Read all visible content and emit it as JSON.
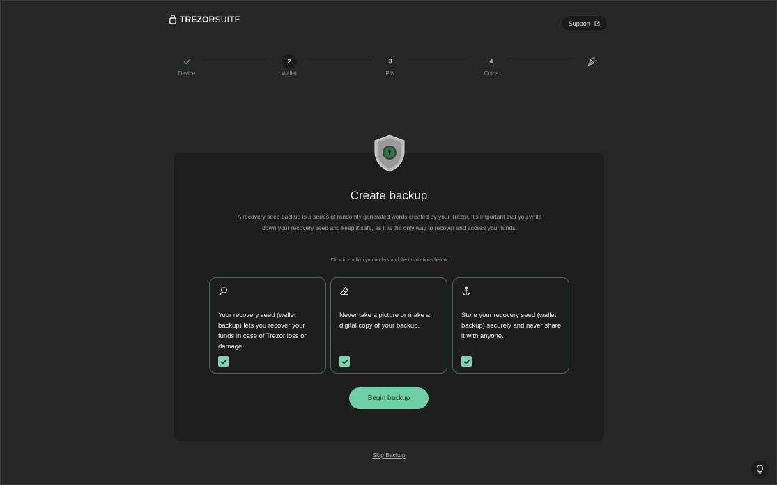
{
  "header": {
    "logo_bold": "TREZOR",
    "logo_light": "SUITE",
    "support_label": "Support"
  },
  "stepper": {
    "steps": [
      {
        "number": "✓",
        "label": "Device",
        "state": "done"
      },
      {
        "number": "2",
        "label": "Wallet",
        "state": "active"
      },
      {
        "number": "3",
        "label": "PIN",
        "state": "pending"
      },
      {
        "number": "4",
        "label": "Coins",
        "state": "pending"
      }
    ],
    "final_icon": "party-popper-icon"
  },
  "backup": {
    "title": "Create backup",
    "description": "A recovery seed backup is a series of randomly generated words created by your Trezor. It's important that you write down your recovery seed and keep it safe, as it is the only way to recover and access your funds.",
    "confirm_hint": "Click to confirm you understand the instructions below",
    "tiles": [
      {
        "icon": "key-icon",
        "text": "Your recovery seed (wallet backup) lets you recover your funds in case of Trezor loss or damage.",
        "checked": true
      },
      {
        "icon": "eraser-icon",
        "text": "Never take a picture or make a digital copy of your backup.",
        "checked": true
      },
      {
        "icon": "anchor-icon",
        "text": "Store your recovery seed (wallet backup) securely and never share it with anyone.",
        "checked": true
      }
    ],
    "begin_label": "Begin backup",
    "skip_label": "Skip Backup"
  },
  "colors": {
    "accent": "#6fcfa6",
    "done_check": "#4fae6a",
    "tile_border": "#3e6b58"
  }
}
